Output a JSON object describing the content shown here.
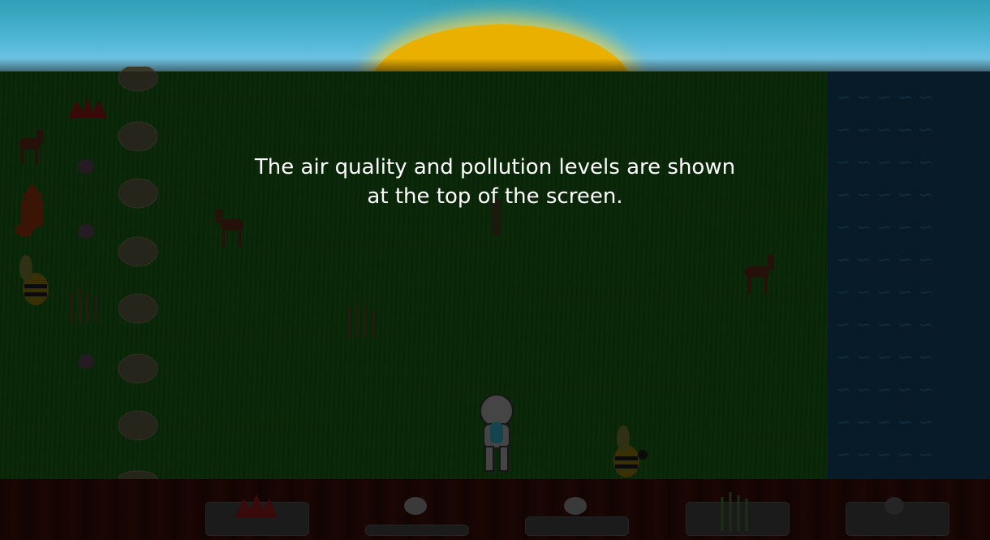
{
  "tutorial": {
    "message": "The air quality and pollution levels are shown at the top of the screen."
  },
  "scene": {
    "sky_color": "#4fb6d6",
    "sun_color": "#e9b000",
    "grass_color": "#124210",
    "water_color": "#0b2b3e",
    "toolbar_color": "#2a0b07"
  },
  "toolbar": {
    "slots": [
      {
        "icon": "flower-icon"
      },
      {
        "icon": "sheep-icon"
      },
      {
        "icon": "sheep-icon"
      },
      {
        "icon": "cactus-icon"
      },
      {
        "icon": "stone-icon"
      }
    ]
  },
  "entities": [
    "tree-icon",
    "flower-icon",
    "deer-icon",
    "fox-icon",
    "bee-icon",
    "cactus-icon",
    "sheep-icon",
    "player-astronaut-icon"
  ]
}
